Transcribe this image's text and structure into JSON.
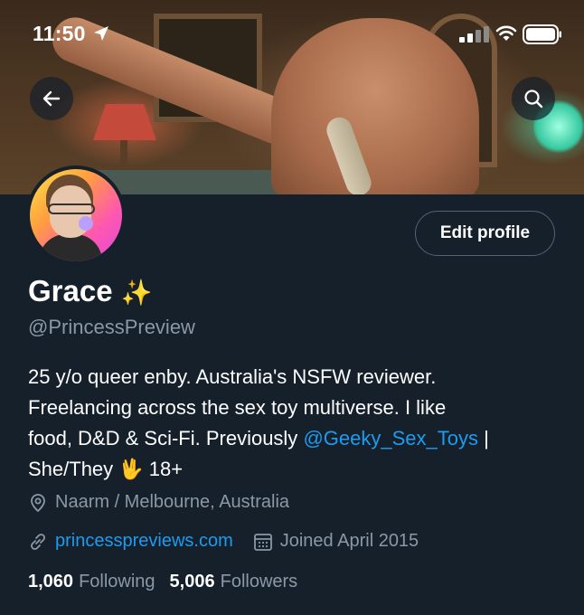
{
  "status_bar": {
    "time": "11:50"
  },
  "profile": {
    "name": "Grace",
    "name_emoji": "✨",
    "handle": "@PrincessPreview",
    "edit_button": "Edit profile",
    "bio": {
      "line1": "25 y/o queer enby. Australia's NSFW reviewer.",
      "line2": "Freelancing across the sex toy multiverse. I like",
      "line3_prefix": "food, D&D & Sci-Fi. Previously ",
      "line3_mention": "@Geeky_Sex_Toys",
      "line3_suffix": " |",
      "line4_prefix": "She/They ",
      "line4_emoji": "🖖",
      "line4_suffix": " 18+"
    },
    "location": "Naarm / Melbourne, Australia",
    "website": "princesspreviews.com",
    "joined": "Joined April 2015",
    "following_count": "1,060",
    "following_label": "Following",
    "followers_count": "5,006",
    "followers_label": "Followers"
  },
  "colors": {
    "background": "#15202b",
    "accent": "#1d9bf0",
    "secondary_text": "#8b98a5",
    "border": "#536471"
  },
  "icons": [
    "location-arrow-icon",
    "signal-icon",
    "wifi-icon",
    "battery-icon",
    "back-arrow-icon",
    "search-icon",
    "location-pin-icon",
    "link-icon",
    "calendar-icon"
  ]
}
